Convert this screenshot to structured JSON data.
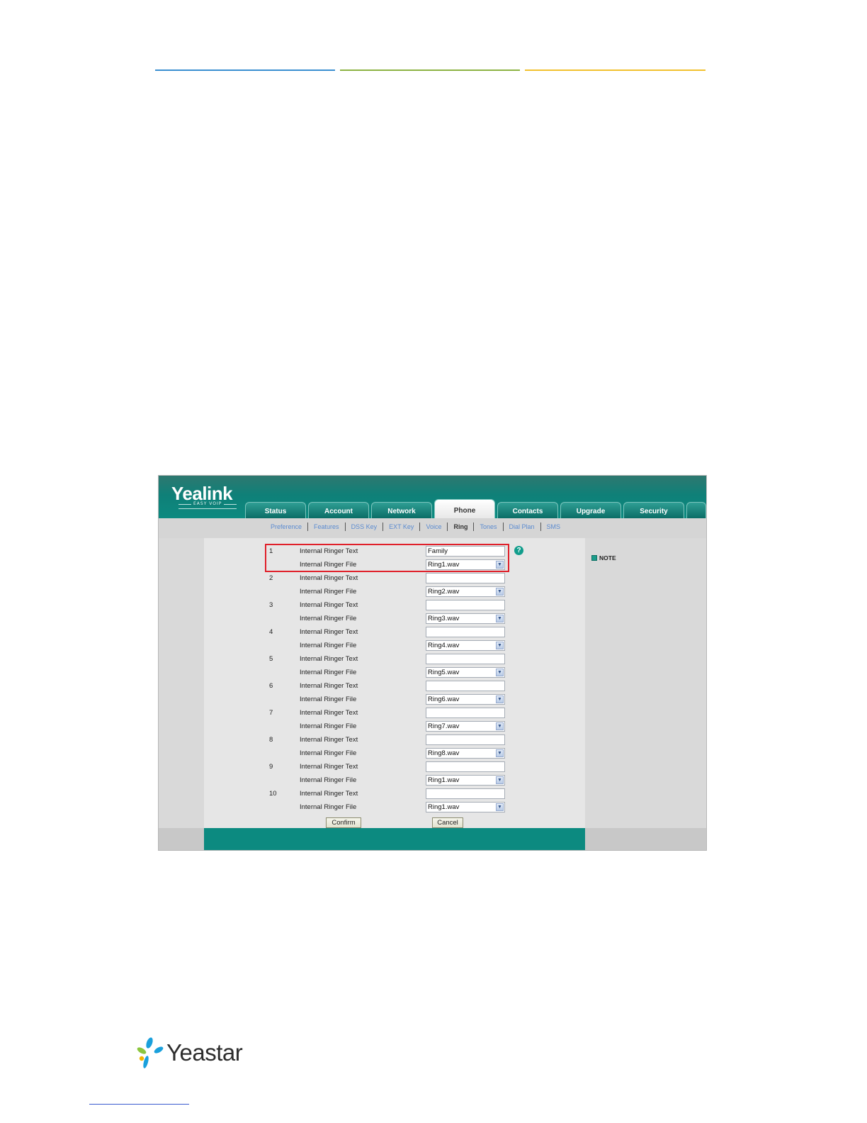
{
  "header": {
    "logo_text": "Yealink",
    "logo_subtext": "EASY VOIP"
  },
  "tabs": [
    {
      "label": "Status",
      "active": false
    },
    {
      "label": "Account",
      "active": false
    },
    {
      "label": "Network",
      "active": false
    },
    {
      "label": "Phone",
      "active": true
    },
    {
      "label": "Contacts",
      "active": false
    },
    {
      "label": "Upgrade",
      "active": false
    },
    {
      "label": "Security",
      "active": false
    }
  ],
  "subnav": [
    {
      "label": "Preference",
      "active": false
    },
    {
      "label": "Features",
      "active": false
    },
    {
      "label": "DSS Key",
      "active": false
    },
    {
      "label": "EXT Key",
      "active": false
    },
    {
      "label": "Voice",
      "active": false
    },
    {
      "label": "Ring",
      "active": true
    },
    {
      "label": "Tones",
      "active": false
    },
    {
      "label": "Dial Plan",
      "active": false
    },
    {
      "label": "SMS",
      "active": false
    }
  ],
  "ringers": [
    {
      "num": "1",
      "text_label": "Internal Ringer Text",
      "text_value": "Family",
      "file_label": "Internal Ringer File",
      "file_value": "Ring1.wav"
    },
    {
      "num": "2",
      "text_label": "Internal Ringer Text",
      "text_value": "",
      "file_label": "Internal Ringer File",
      "file_value": "Ring2.wav"
    },
    {
      "num": "3",
      "text_label": "Internal Ringer Text",
      "text_value": "",
      "file_label": "Internal Ringer File",
      "file_value": "Ring3.wav"
    },
    {
      "num": "4",
      "text_label": "Internal Ringer Text",
      "text_value": "",
      "file_label": "Internal Ringer File",
      "file_value": "Ring4.wav"
    },
    {
      "num": "5",
      "text_label": "Internal Ringer Text",
      "text_value": "",
      "file_label": "Internal Ringer File",
      "file_value": "Ring5.wav"
    },
    {
      "num": "6",
      "text_label": "Internal Ringer Text",
      "text_value": "",
      "file_label": "Internal Ringer File",
      "file_value": "Ring6.wav"
    },
    {
      "num": "7",
      "text_label": "Internal Ringer Text",
      "text_value": "",
      "file_label": "Internal Ringer File",
      "file_value": "Ring7.wav"
    },
    {
      "num": "8",
      "text_label": "Internal Ringer Text",
      "text_value": "",
      "file_label": "Internal Ringer File",
      "file_value": "Ring8.wav"
    },
    {
      "num": "9",
      "text_label": "Internal Ringer Text",
      "text_value": "",
      "file_label": "Internal Ringer File",
      "file_value": "Ring1.wav"
    },
    {
      "num": "10",
      "text_label": "Internal Ringer Text",
      "text_value": "",
      "file_label": "Internal Ringer File",
      "file_value": "Ring1.wav"
    }
  ],
  "help_icon": "?",
  "buttons": {
    "confirm": "Confirm",
    "cancel": "Cancel"
  },
  "note": {
    "label": "NOTE"
  },
  "footer_logo": {
    "text": "Yeastar"
  },
  "colors": {
    "teal": "#0c8a80",
    "highlight_red": "#e0202a",
    "link_blue": "#5b8bd0"
  }
}
